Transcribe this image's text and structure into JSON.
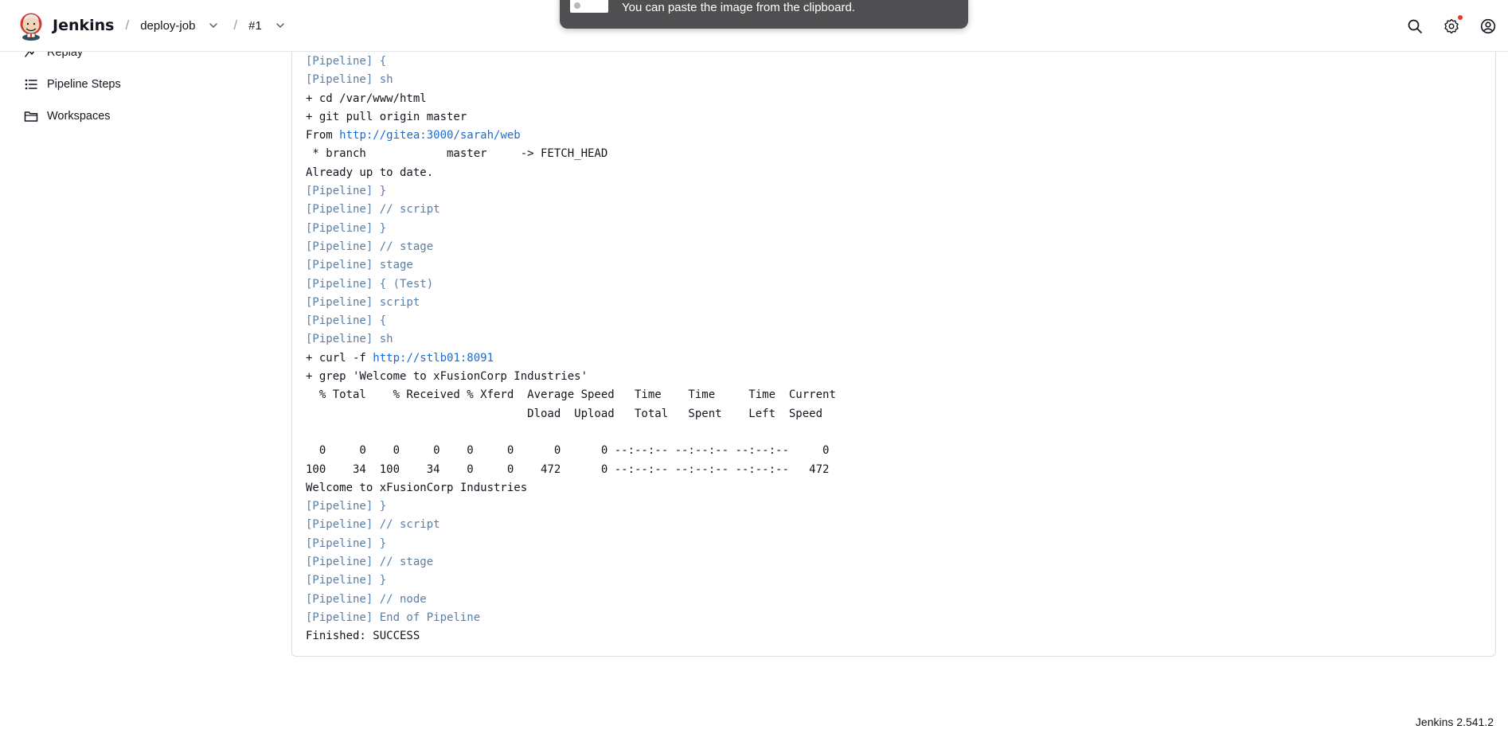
{
  "header": {
    "brand": "Jenkins",
    "breadcrumbs": [
      {
        "label": "deploy-job"
      },
      {
        "label": "#1"
      }
    ],
    "icons": [
      "search-icon",
      "gear-icon",
      "user-icon"
    ],
    "notification_color": "#e5392b"
  },
  "toast": {
    "message": "You can paste the image from the clipboard."
  },
  "sidebar": {
    "items": [
      {
        "label": "Replay",
        "icon": "replay-icon"
      },
      {
        "label": "Pipeline Steps",
        "icon": "list-icon"
      },
      {
        "label": "Workspaces",
        "icon": "folder-icon"
      }
    ]
  },
  "console": {
    "lines": [
      {
        "type": "pipeline",
        "text": "[Pipeline] {"
      },
      {
        "type": "pipeline",
        "text": "[Pipeline] sh"
      },
      {
        "type": "plain",
        "text": "+ cd /var/www/html"
      },
      {
        "type": "plain",
        "text": "+ git pull origin master"
      },
      {
        "type": "link",
        "prefix": "From ",
        "link": "http://gitea:3000/sarah/web"
      },
      {
        "type": "plain",
        "text": " * branch            master     -> FETCH_HEAD"
      },
      {
        "type": "plain",
        "text": "Already up to date."
      },
      {
        "type": "pipeline",
        "text": "[Pipeline] }"
      },
      {
        "type": "pipeline",
        "text": "[Pipeline] // script"
      },
      {
        "type": "pipeline",
        "text": "[Pipeline] }"
      },
      {
        "type": "pipeline",
        "text": "[Pipeline] // stage"
      },
      {
        "type": "pipeline",
        "text": "[Pipeline] stage"
      },
      {
        "type": "pipeline",
        "text": "[Pipeline] { (Test)"
      },
      {
        "type": "pipeline",
        "text": "[Pipeline] script"
      },
      {
        "type": "pipeline",
        "text": "[Pipeline] {"
      },
      {
        "type": "pipeline",
        "text": "[Pipeline] sh"
      },
      {
        "type": "link",
        "prefix": "+ curl -f ",
        "link": "http://stlb01:8091"
      },
      {
        "type": "plain",
        "text": "+ grep 'Welcome to xFusionCorp Industries'"
      },
      {
        "type": "plain",
        "text": "  % Total    % Received % Xferd  Average Speed   Time    Time     Time  Current"
      },
      {
        "type": "plain",
        "text": "                                 Dload  Upload   Total   Spent    Left  Speed"
      },
      {
        "type": "plain",
        "text": ""
      },
      {
        "type": "plain",
        "text": "  0     0    0     0    0     0      0      0 --:--:-- --:--:-- --:--:--     0"
      },
      {
        "type": "plain",
        "text": "100    34  100    34    0     0    472      0 --:--:-- --:--:-- --:--:--   472"
      },
      {
        "type": "plain",
        "text": "Welcome to xFusionCorp Industries"
      },
      {
        "type": "pipeline",
        "text": "[Pipeline] }"
      },
      {
        "type": "pipeline",
        "text": "[Pipeline] // script"
      },
      {
        "type": "pipeline",
        "text": "[Pipeline] }"
      },
      {
        "type": "pipeline",
        "text": "[Pipeline] // stage"
      },
      {
        "type": "pipeline",
        "text": "[Pipeline] }"
      },
      {
        "type": "pipeline",
        "text": "[Pipeline] // node"
      },
      {
        "type": "pipeline",
        "text": "[Pipeline] End of Pipeline"
      },
      {
        "type": "plain",
        "text": "Finished: SUCCESS"
      }
    ],
    "colors": {
      "pipeline": "#5b7ea3",
      "link": "#1a6bd1",
      "text": "#14141f"
    }
  },
  "footer": {
    "version": "Jenkins 2.541.2"
  }
}
